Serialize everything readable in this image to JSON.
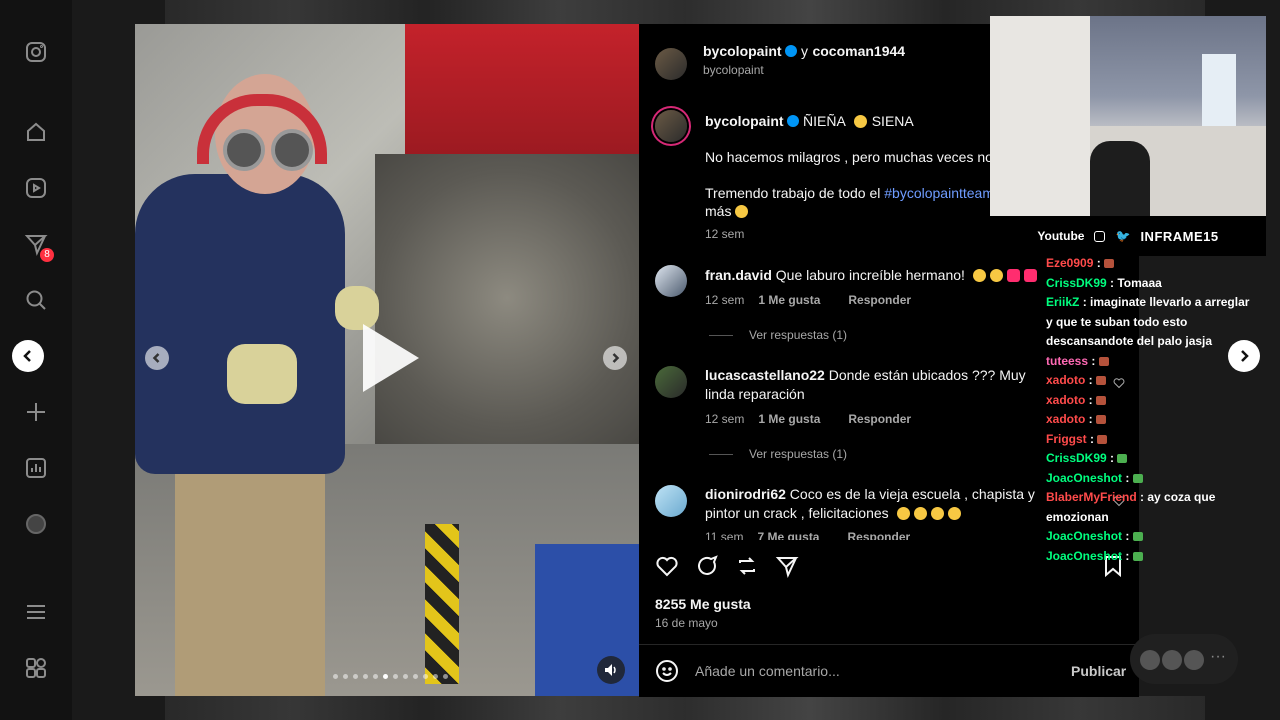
{
  "sidebar": {
    "items": [
      {
        "icon": "instagram-icon"
      },
      {
        "icon": "home-icon"
      },
      {
        "icon": "reels-icon"
      },
      {
        "icon": "direct-messages-icon",
        "badge": "8"
      },
      {
        "icon": "search-icon"
      },
      {
        "icon": "create-icon"
      },
      {
        "icon": "dashboard-icon"
      },
      {
        "icon": "profile-avatar"
      },
      {
        "icon": "menu-icon"
      },
      {
        "icon": "more-apps-icon"
      }
    ]
  },
  "post": {
    "author": "bycolopaint",
    "coauthor_joiner": "y",
    "coauthor": "cocoman1944",
    "subtitle": "bycolopaint",
    "caption": {
      "username": "bycolopaint",
      "headline": "ÑIEÑA",
      "headline2": "SIENA",
      "line1": "No hacemos milagros , pero muchas veces nos",
      "line2_prefix": "Tremendo trabajo de todo el",
      "hashtag": "#bycolopaintteam",
      "line3": "más",
      "time": "12 sem"
    },
    "comments": [
      {
        "username": "fran.david",
        "text": "Que laburo increíble hermano!",
        "time": "12 sem",
        "likes": "1 Me gusta",
        "reply": "Responder",
        "view_replies": "Ver respuestas (1)"
      },
      {
        "username": "lucascastellano22",
        "text": "Donde están ubicados ??? Muy linda reparación",
        "time": "12 sem",
        "likes": "1 Me gusta",
        "reply": "Responder",
        "view_replies": "Ver respuestas (1)"
      },
      {
        "username": "dionirodri62",
        "text": "Coco es de la vieja escuela , chapista y pintor un crack , felicitaciones",
        "time": "11 sem",
        "likes": "7 Me gusta",
        "reply": "Responder"
      }
    ],
    "likes": "8255 Me gusta",
    "date": "16 de mayo",
    "comment_placeholder": "Añade un comentario...",
    "publish": "Publicar"
  },
  "stream": {
    "youtube": "Youtube",
    "brand": "INFRAME15"
  },
  "chat": [
    {
      "user": "Eze0909",
      "text": "",
      "color": "#ff4b4b"
    },
    {
      "user": "CrissDK99",
      "text": "Tomaaa",
      "color": "#00ff7f"
    },
    {
      "user": "EriikZ",
      "text": "imaginate llevarlo a arreglar y que te suban todo esto descansandote del palo jasja",
      "color": "#00ff7f"
    },
    {
      "user": "tuteess",
      "text": "",
      "color": "#ff69b4"
    },
    {
      "user": "xadoto",
      "text": "",
      "color": "#ff4b4b"
    },
    {
      "user": "xadoto",
      "text": "",
      "color": "#ff4b4b"
    },
    {
      "user": "xadoto",
      "text": "",
      "color": "#ff4b4b"
    },
    {
      "user": "Friggst",
      "text": "",
      "color": "#ff4b4b"
    },
    {
      "user": "CrissDK99",
      "text": "",
      "color": "#00ff7f"
    },
    {
      "user": "JoacOneshot",
      "text": "",
      "color": "#00ff7f"
    },
    {
      "user": "BlaberMyFriend",
      "text": "ay coza que emozionan",
      "color": "#ff4b4b"
    },
    {
      "user": "JoacOneshot",
      "text": "",
      "color": "#00ff7f"
    },
    {
      "user": "JoacOneshot",
      "text": "",
      "color": "#00ff7f"
    }
  ],
  "colors": {
    "accent": "#0095f6",
    "link": "#6f9cff",
    "badge": "#ff3040"
  }
}
